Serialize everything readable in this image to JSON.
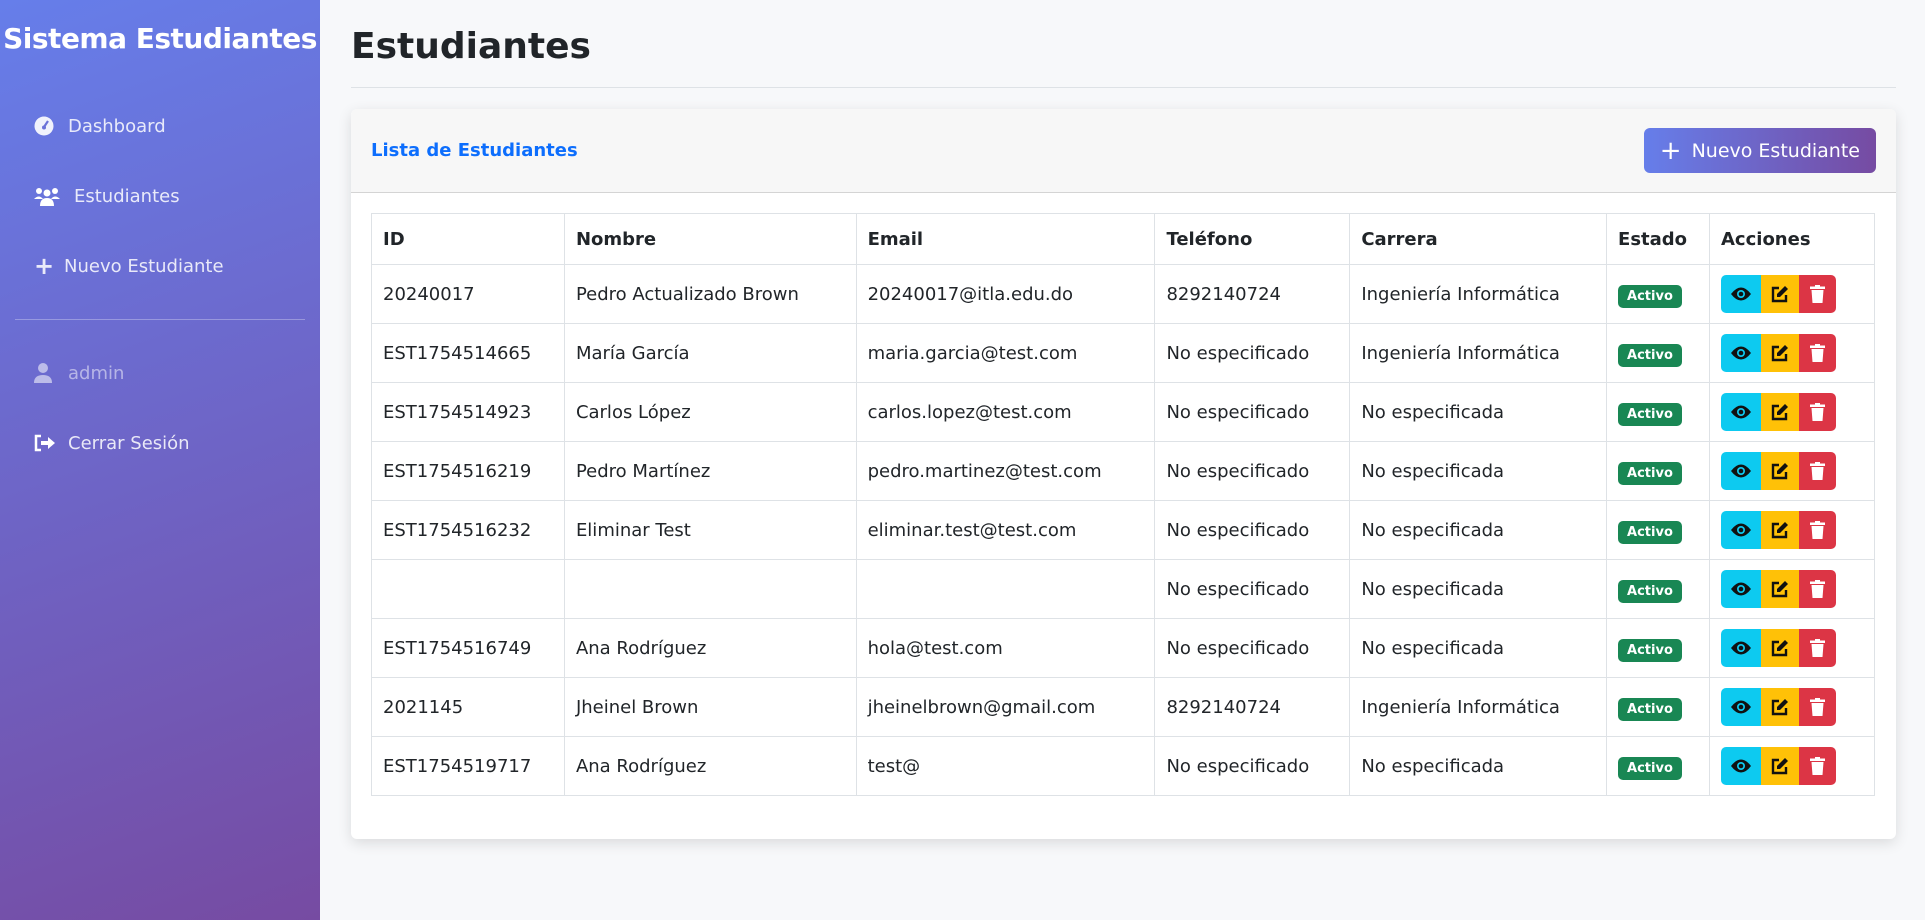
{
  "sidebar": {
    "brand": "Sistema Estudiantes",
    "items": [
      {
        "label": "Dashboard",
        "icon": "gauge-icon"
      },
      {
        "label": "Estudiantes",
        "icon": "users-icon"
      },
      {
        "label": "Nuevo Estudiante",
        "icon": "plus-icon"
      }
    ],
    "user": "admin",
    "logout": "Cerrar Sesión"
  },
  "page": {
    "title": "Estudiantes"
  },
  "card": {
    "title": "Lista de Estudiantes",
    "new_button": "Nuevo Estudiante"
  },
  "table": {
    "headers": [
      "ID",
      "Nombre",
      "Email",
      "Teléfono",
      "Carrera",
      "Estado",
      "Acciones"
    ],
    "rows": [
      [
        "20240017",
        "Pedro Actualizado Brown",
        "20240017@itla.edu.do",
        "8292140724",
        "Ingeniería Informática",
        "Activo"
      ],
      [
        "EST1754514665",
        "María García",
        "maria.garcia@test.com",
        "No especificado",
        "Ingeniería Informática",
        "Activo"
      ],
      [
        "EST1754514923",
        "Carlos López",
        "carlos.lopez@test.com",
        "No especificado",
        "No especificada",
        "Activo"
      ],
      [
        "EST1754516219",
        "Pedro Martínez",
        "pedro.martinez@test.com",
        "No especificado",
        "No especificada",
        "Activo"
      ],
      [
        "EST1754516232",
        "Eliminar Test",
        "eliminar.test@test.com",
        "No especificado",
        "No especificada",
        "Activo"
      ],
      [
        "",
        "",
        "",
        "No especificado",
        "No especificada",
        "Activo"
      ],
      [
        "EST1754516749",
        "Ana Rodríguez",
        "hola@test.com",
        "No especificado",
        "No especificada",
        "Activo"
      ],
      [
        "2021145",
        "Jheinel Brown",
        "jheinelbrown@gmail.com",
        "8292140724",
        "Ingeniería Informática",
        "Activo"
      ],
      [
        "EST1754519717",
        "Ana Rodríguez",
        "test@",
        "No especificado",
        "No especificada",
        "Activo"
      ]
    ]
  },
  "colors": {
    "sidebar_from": "#667eea",
    "sidebar_to": "#764ba2",
    "active": "#198754",
    "view": "#0dcaf0",
    "edit": "#ffc107",
    "delete": "#dc3545"
  }
}
